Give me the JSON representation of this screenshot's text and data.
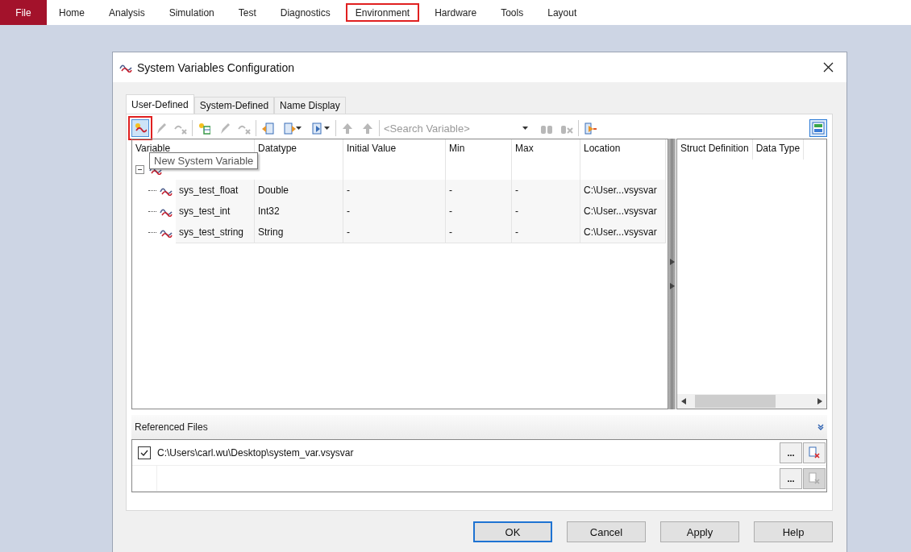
{
  "menu": [
    {
      "label": "File",
      "selected": true,
      "highlighted": false
    },
    {
      "label": "Home",
      "selected": false,
      "highlighted": false
    },
    {
      "label": "Analysis",
      "selected": false,
      "highlighted": false
    },
    {
      "label": "Simulation",
      "selected": false,
      "highlighted": false
    },
    {
      "label": "Test",
      "selected": false,
      "highlighted": false
    },
    {
      "label": "Diagnostics",
      "selected": false,
      "highlighted": false
    },
    {
      "label": "Environment",
      "selected": false,
      "highlighted": true
    },
    {
      "label": "Hardware",
      "selected": false,
      "highlighted": false
    },
    {
      "label": "Tools",
      "selected": false,
      "highlighted": false
    },
    {
      "label": "Layout",
      "selected": false,
      "highlighted": false
    }
  ],
  "dialog": {
    "title": "System Variables Configuration",
    "tabs": [
      {
        "label": "User-Defined",
        "selected": true
      },
      {
        "label": "System-Defined",
        "selected": false
      },
      {
        "label": "Name Display",
        "selected": false
      }
    ],
    "toolbar": [
      {
        "kind": "new",
        "disabled": false,
        "highlighted": true
      },
      {
        "kind": "edit",
        "disabled": true,
        "highlighted": false
      },
      {
        "kind": "delete",
        "disabled": true,
        "highlighted": false
      },
      {
        "kind": "sep"
      },
      {
        "kind": "new-struct",
        "disabled": false,
        "highlighted": false
      },
      {
        "kind": "edit",
        "disabled": true,
        "highlighted": false
      },
      {
        "kind": "delete",
        "disabled": true,
        "highlighted": false
      },
      {
        "kind": "sep"
      },
      {
        "kind": "import",
        "disabled": false,
        "highlighted": false
      },
      {
        "kind": "export",
        "disabled": false,
        "highlighted": false
      },
      {
        "kind": "export-menu",
        "disabled": false,
        "highlighted": false
      },
      {
        "kind": "sep"
      },
      {
        "kind": "up",
        "disabled": true,
        "highlighted": false
      },
      {
        "kind": "up",
        "disabled": true,
        "highlighted": false
      },
      {
        "kind": "sep"
      }
    ],
    "search": {
      "placeholder": "<Search Variable>"
    },
    "toolbar_right": [
      {
        "kind": "find",
        "disabled": true
      },
      {
        "kind": "find-clear",
        "disabled": true
      },
      {
        "kind": "sep"
      },
      {
        "kind": "filter",
        "disabled": false
      }
    ],
    "tooltip": "New System Variable",
    "grid": {
      "columns": [
        "Variable",
        "Datatype",
        "Initial Value",
        "Min",
        "Max",
        "Location"
      ],
      "namespace": {
        "expanded": true
      },
      "rows": [
        [
          "sys_test_float",
          "Double",
          "-",
          "-",
          "-",
          "C:\\User...vsysvar"
        ],
        [
          "sys_test_int",
          "Int32",
          "-",
          "-",
          "-",
          "C:\\User...vsysvar"
        ],
        [
          "sys_test_string",
          "String",
          "-",
          "-",
          "-",
          "C:\\User...vsysvar"
        ]
      ]
    },
    "struct_pane": {
      "columns": [
        "Struct Definition",
        "Data Type"
      ]
    },
    "referenced_files": {
      "title": "Referenced Files",
      "rows": [
        {
          "path": "C:\\Users\\carl.wu\\Desktop\\system_var.vsysvar",
          "checked": true,
          "browse": "...",
          "remove_disabled": false
        },
        {
          "path": "",
          "browse": "...",
          "remove_disabled": true
        }
      ]
    },
    "buttons": [
      {
        "label": "OK",
        "selected": true
      },
      {
        "label": "Cancel",
        "selected": false
      },
      {
        "label": "Apply",
        "selected": false
      },
      {
        "label": "Help",
        "selected": false
      }
    ]
  }
}
